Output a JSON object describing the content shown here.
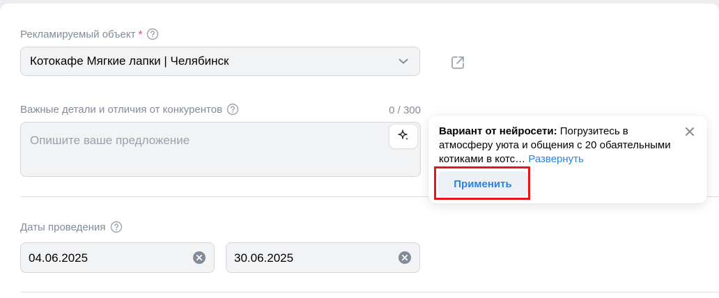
{
  "ad_object": {
    "label": "Рекламируемый объект",
    "required_mark": "*",
    "selected_value": "Котокафе Мягкие лапки | Челябинск"
  },
  "details": {
    "label": "Важные детали и отличия от конкурентов",
    "counter": "0 / 300",
    "placeholder": "Опишите ваше предложение"
  },
  "ai_suggestion": {
    "prefix": "Вариант от нейросети:",
    "text": " Погрузитесь в атмосферу уюта и общения с 20 обаятельными котиками в котс… ",
    "expand_label": "Развернуть",
    "apply_label": "Применить"
  },
  "dates": {
    "label": "Даты проведения",
    "start": "04.06.2025",
    "end": "30.06.2025"
  },
  "colors": {
    "accent": "#2d81e0",
    "highlight": "#e8131b",
    "muted_text": "#818c99",
    "field_bg": "#f2f3f5"
  },
  "icons": {
    "help": "question-circle-icon",
    "chevron": "chevron-down-icon",
    "external": "external-link-icon",
    "ai": "sparkle-icon",
    "close": "close-icon",
    "clear": "clear-circle-icon"
  }
}
